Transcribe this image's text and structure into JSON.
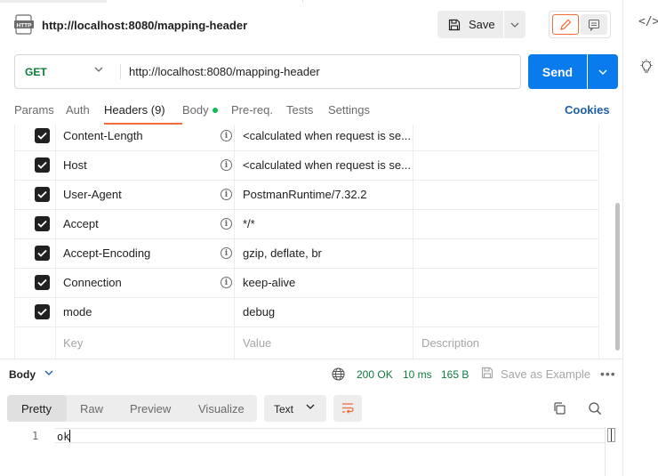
{
  "request": {
    "title": "http://localhost:8080/mapping-header",
    "save_label": "Save",
    "method": "GET",
    "url": "http://localhost:8080/mapping-header",
    "send_label": "Send"
  },
  "tabs": {
    "params": "Params",
    "auth": "Auth",
    "headers": "Headers (9)",
    "body": "Body",
    "prereq": "Pre-req.",
    "tests": "Tests",
    "settings": "Settings",
    "cookies": "Cookies"
  },
  "headers": {
    "rows": [
      {
        "key": "Content-Length",
        "value": "<calculated when request is se...",
        "checked": true,
        "info": true
      },
      {
        "key": "Host",
        "value": "<calculated when request is se...",
        "checked": true,
        "info": true
      },
      {
        "key": "User-Agent",
        "value": "PostmanRuntime/7.32.2",
        "checked": true,
        "info": true
      },
      {
        "key": "Accept",
        "value": "*/*",
        "checked": true,
        "info": true
      },
      {
        "key": "Accept-Encoding",
        "value": "gzip, deflate, br",
        "checked": true,
        "info": true
      },
      {
        "key": "Connection",
        "value": "keep-alive",
        "checked": true,
        "info": true
      },
      {
        "key": "mode",
        "value": "debug",
        "checked": true,
        "info": false
      }
    ],
    "placeholder": {
      "key": "Key",
      "value": "Value",
      "description": "Description"
    }
  },
  "response": {
    "body_label": "Body",
    "status": "200 OK",
    "time": "10 ms",
    "size": "165 B",
    "save_example": "Save as Example",
    "view_tabs": [
      "Pretty",
      "Raw",
      "Preview",
      "Visualize"
    ],
    "format": "Text",
    "line_number": "1",
    "content": "ok"
  },
  "icons": {
    "rail_code": "</>"
  },
  "colors": {
    "accent": "#f26b3a",
    "send": "#097bed",
    "status_green": "#0f7a3e",
    "method_green": "#0f7a3e"
  }
}
